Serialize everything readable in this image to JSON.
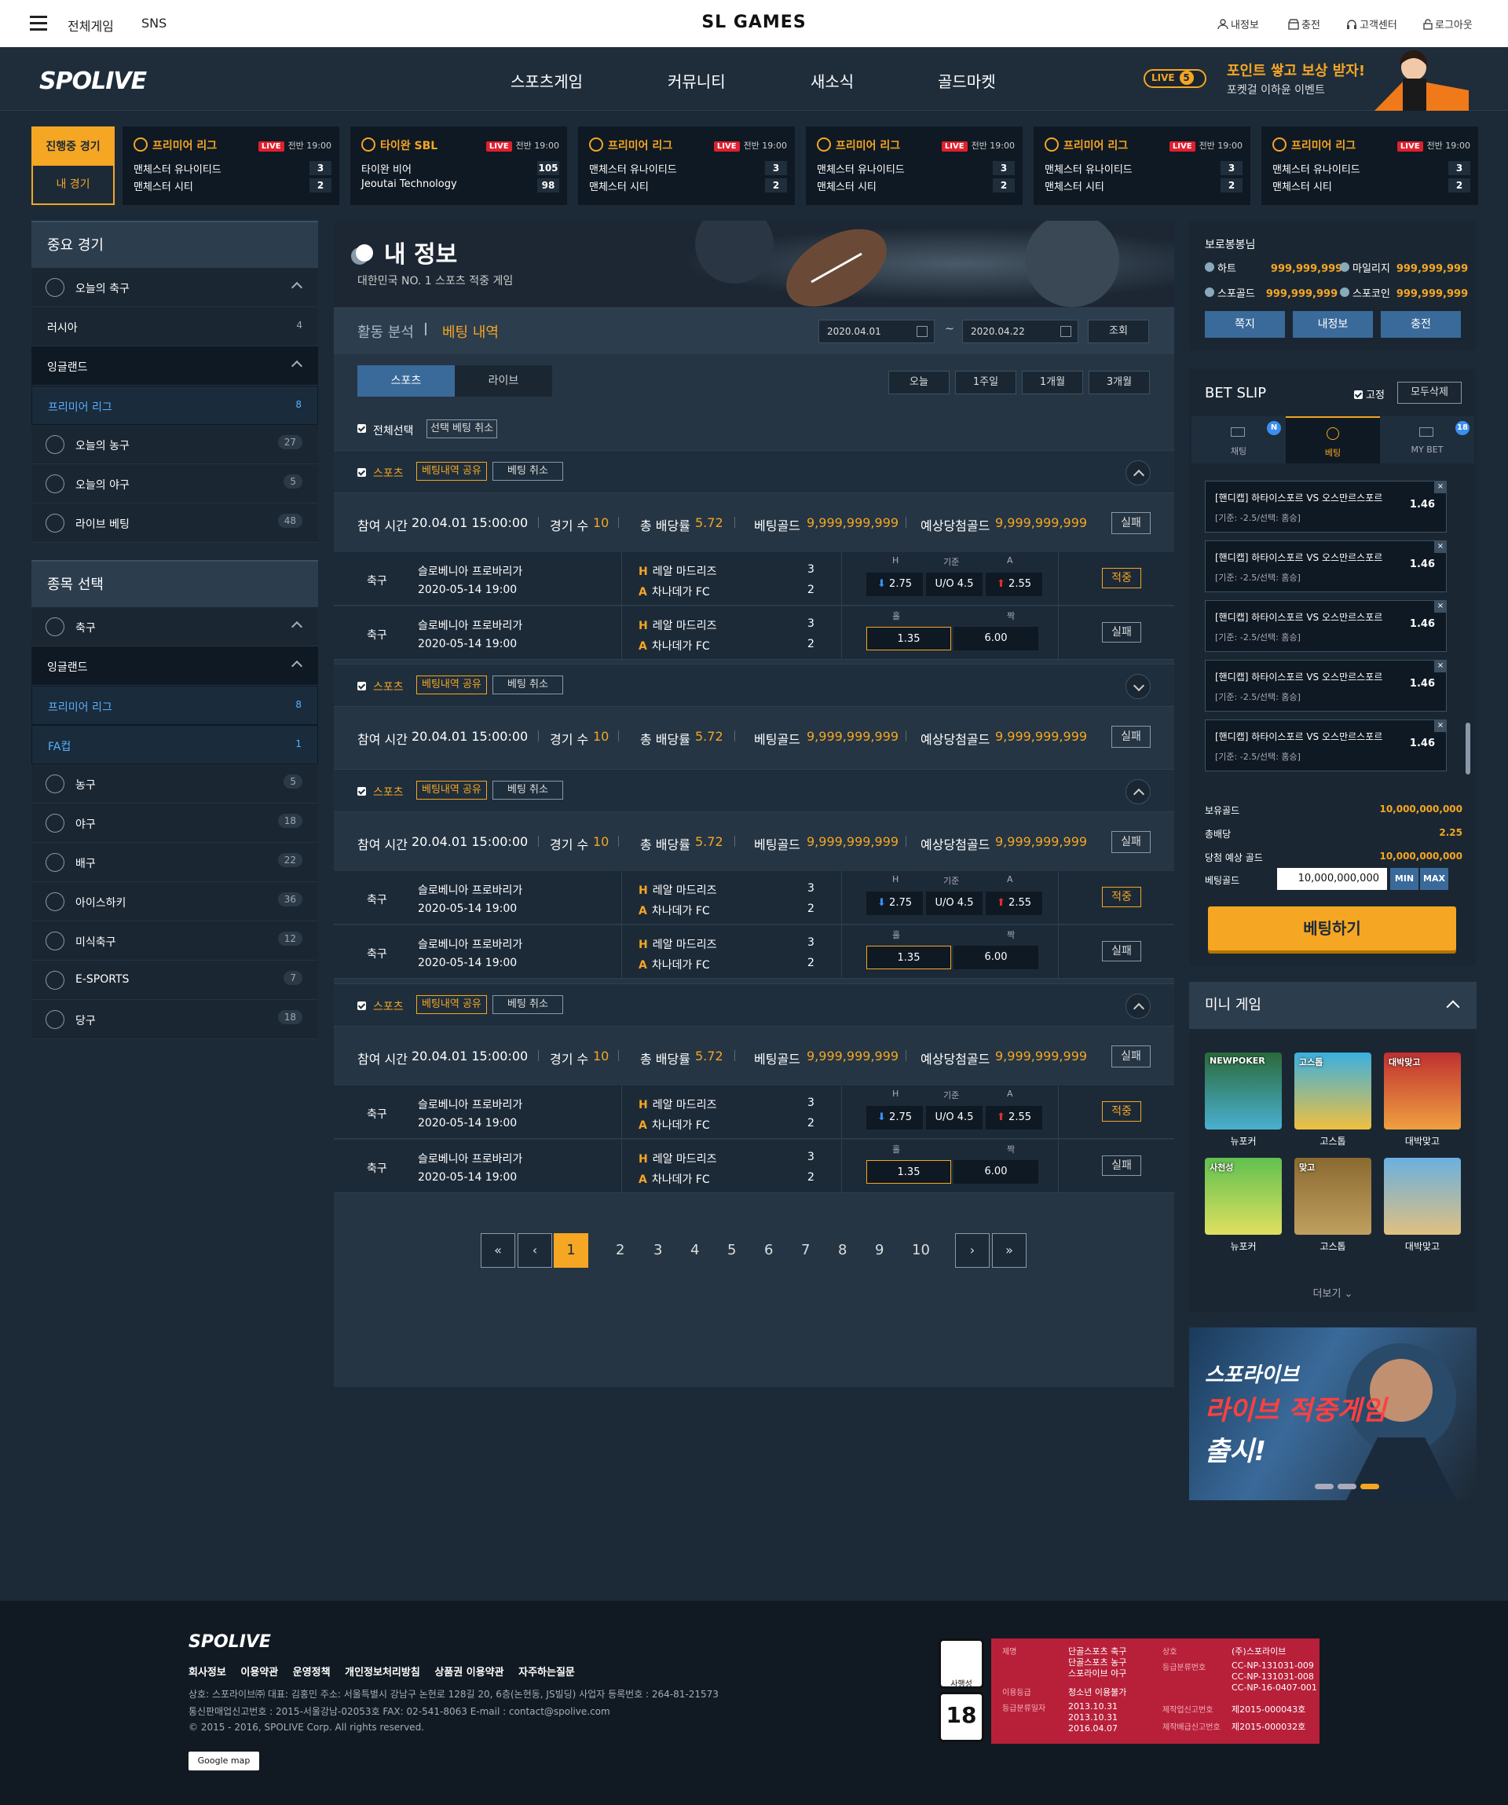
{
  "topbar": {
    "all_games": "전체게임",
    "sns": "SNS",
    "title": "SL GAMES",
    "my_info": "내정보",
    "charge": "충전",
    "support": "고객센터",
    "logout": "로그아웃"
  },
  "nav": {
    "logo": "SPOLIVE",
    "items": [
      "스포츠게임",
      "커뮤니티",
      "새소식",
      "골드마켓"
    ],
    "live_label": "LIVE",
    "live_count": "5",
    "promo_title": "포인트 쌓고 보상 받자!",
    "promo_sub": "포켓걸 이하윤 이벤트"
  },
  "strip": {
    "tab_live": "진행중 경기",
    "tab_mine": "내 경기",
    "matches": [
      {
        "league": "프리미어 리그",
        "live": "LIVE",
        "time": "전반 19:00",
        "home": "맨체스터 유나이티드",
        "away": "맨체스터 시티",
        "hs": "3",
        "as": "2"
      },
      {
        "league": "타이완 SBL",
        "live": "LIVE",
        "time": "전반 19:00",
        "home": "타이완 비어",
        "away": "Jeoutai Technology",
        "hs": "105",
        "as": "98"
      },
      {
        "league": "프리미어 리그",
        "live": "LIVE",
        "time": "전반 19:00",
        "home": "맨체스터 유나이티드",
        "away": "맨체스터 시티",
        "hs": "3",
        "as": "2"
      },
      {
        "league": "프리미어 리그",
        "live": "LIVE",
        "time": "전반 19:00",
        "home": "맨체스터 유나이티드",
        "away": "맨체스터 시티",
        "hs": "3",
        "as": "2"
      },
      {
        "league": "프리미어 리그",
        "live": "LIVE",
        "time": "전반 19:00",
        "home": "맨체스터 유나이티드",
        "away": "맨체스터 시티",
        "hs": "3",
        "as": "2"
      },
      {
        "league": "프리미어 리그",
        "live": "LIVE",
        "time": "전반 19:00",
        "home": "맨체스터 유나이티드",
        "away": "맨체스터 시티",
        "hs": "3",
        "as": "2"
      }
    ]
  },
  "left": {
    "h1": "중요 경기",
    "h2": "종목 선택",
    "group1": [
      {
        "label": "오늘의 축구",
        "count": "",
        "type": "icon",
        "up": true,
        "icon": "soccer-icon"
      },
      {
        "label": "러시아",
        "count": "4",
        "type": "sub"
      },
      {
        "label": "잉글랜드",
        "count": "",
        "type": "sub",
        "up": true,
        "dark": true
      },
      {
        "label": "프리미어 리그",
        "count": "8",
        "type": "sub",
        "sel": true
      },
      {
        "label": "오늘의 농구",
        "count": "27",
        "type": "icon",
        "icon": "basketball-icon",
        "round": true
      },
      {
        "label": "오늘의 야구",
        "count": "5",
        "type": "icon",
        "icon": "baseball-icon",
        "round": true
      },
      {
        "label": "라이브 베팅",
        "count": "48",
        "type": "icon",
        "icon": "live-icon",
        "round": true
      }
    ],
    "group2": [
      {
        "label": "축구",
        "count": "",
        "type": "icon",
        "up": true,
        "icon": "soccer-icon"
      },
      {
        "label": "잉글랜드",
        "count": "",
        "type": "sub",
        "up": true,
        "dark": true
      },
      {
        "label": "프리미어 리그",
        "count": "8",
        "type": "sub",
        "sel": true
      },
      {
        "label": "FA컵",
        "count": "1",
        "type": "sub",
        "sel": true
      },
      {
        "label": "농구",
        "count": "5",
        "type": "icon",
        "icon": "basketball-icon",
        "round": true
      },
      {
        "label": "야구",
        "count": "18",
        "type": "icon",
        "icon": "baseball-icon",
        "round": true
      },
      {
        "label": "배구",
        "count": "22",
        "type": "icon",
        "icon": "volleyball-icon",
        "round": true
      },
      {
        "label": "아이스하키",
        "count": "36",
        "type": "icon",
        "icon": "hockey-icon",
        "round": true
      },
      {
        "label": "미식축구",
        "count": "12",
        "type": "icon",
        "icon": "football-icon",
        "round": true
      },
      {
        "label": "E-SPORTS",
        "count": "7",
        "type": "icon",
        "icon": "esports-icon",
        "round": true
      },
      {
        "label": "당구",
        "count": "18",
        "type": "icon",
        "icon": "billiards-icon",
        "round": true
      }
    ]
  },
  "main": {
    "title": "내 정보",
    "subtitle": "대한민국 NO. 1 스포츠 적중 게임",
    "tab_analysis": "활동 분석",
    "tab_history": "베팅 내역",
    "date_from": "2020.04.01",
    "date_to": "2020.04.22",
    "tilde": "~",
    "search": "조회",
    "tab_sports": "스포츠",
    "tab_live": "라이브",
    "periods": [
      "오늘",
      "1주일",
      "1개월",
      "3개월"
    ],
    "select_all": "전체선택",
    "cancel_selected": "선택 베팅 취소",
    "group_label": "스포츠",
    "share": "베팅내역 공유",
    "cancel": "베팅 취소",
    "sum": {
      "time_k": "참여 시간",
      "time_v": "20.04.01 15:00:00",
      "games_k": "경기 수",
      "games_v": "10",
      "odds_k": "총 배당률",
      "odds_v": "5.72",
      "gold_k": "베팅골드",
      "gold_v": "9,999,999,999",
      "exp_k": "예상당첨골드",
      "exp_v": "9,999,999,999",
      "result": "실패"
    },
    "row1": {
      "sport": "축구",
      "league": "슬로베니아 프로바리가",
      "date": "2020-05-14 19:00",
      "hm": "H",
      "home": "레알 마드리즈",
      "aw": "A",
      "away": "차나데가 FC",
      "s1": "3",
      "s2": "2",
      "lh": "H",
      "lm": "기준",
      "la": "A",
      "o1": "2.75",
      "o2": "U/O 4.5",
      "o3": "2.55",
      "result": "적중"
    },
    "row2": {
      "sport": "축구",
      "league": "슬로베니아 프로바리가",
      "date": "2020-05-14 19:00",
      "hm": "H",
      "home": "레알 마드리즈",
      "aw": "A",
      "away": "차나데가 FC",
      "s1": "3",
      "s2": "2",
      "lh": "홀",
      "la": "짝",
      "o1": "1.35",
      "o3": "6.00",
      "result": "실패"
    },
    "pages": [
      "1",
      "2",
      "3",
      "4",
      "5",
      "6",
      "7",
      "8",
      "9",
      "10"
    ]
  },
  "wallet": {
    "title": "보로봉봉님",
    "heart_k": "하트",
    "heart_v": "999,999,999",
    "mileage_k": "마일리지",
    "mileage_v": "999,999,999",
    "sgold_k": "스포골드",
    "sgold_v": "999,999,999",
    "scoin_k": "스포코인",
    "scoin_v": "999,999,999",
    "btn1": "쪽지",
    "btn2": "내정보",
    "btn3": "충전"
  },
  "slip": {
    "title": "BET SLIP",
    "fixed": "고정",
    "delete_all": "모두삭제",
    "tab1": "채팅",
    "tab1_badge": "N",
    "tab2": "베팅",
    "tab3": "MY BET",
    "tab3_badge": "18",
    "item_title": "[핸디캡] 하타이스포르 VS 오스만르스포르",
    "item_sub": "[기준: -2.5/선택: 홈승]",
    "item_odds": "1.46",
    "item_x": "×",
    "hold_k": "보유골드",
    "hold_v": "10,000,000,000",
    "odds_k": "총배당",
    "odds_v": "2.25",
    "exp_k": "당첨 예상 골드",
    "exp_v": "10,000,000,000",
    "bet_k": "베팅골드",
    "bet_v": "10,000,000,000",
    "min": "MIN",
    "max": "MAX",
    "bet_btn": "베팅하기"
  },
  "mini": {
    "title": "미니 게임",
    "games": [
      {
        "label": "뉴포커",
        "badge": "NEWPOKER"
      },
      {
        "label": "고스톱",
        "badge": "고스톱"
      },
      {
        "label": "대박맞고",
        "badge": "대박맞고"
      },
      {
        "label": "뉴포커",
        "badge": "사천성"
      },
      {
        "label": "고스톱",
        "badge": "맞고"
      },
      {
        "label": "대박맞고",
        "badge": ""
      }
    ],
    "more": "더보기"
  },
  "banner": {
    "l1": "스포라이브",
    "l2": "라이브 적중게임",
    "l3": "출시!"
  },
  "footer": {
    "logo": "SPOLIVE",
    "links": [
      "회사정보",
      "이용약관",
      "운영정책",
      "개인정보처리방침",
      "상품권 이용약관",
      "자주하는질문"
    ],
    "line1": "상호: 스포라이브㈜    대표: 김홍민    주소: 서울특별시 강남구 논현로 128길 20, 6층(논현동, JS빌딩)    사업자 등록번호 : 264-81-21573",
    "line2": "통신판매업신고번호 : 2015-서울강남-02053호    FAX: 02-541-8063    E-mail : contact@spolive.com",
    "line3": "© 2015 - 2016, SPOLIVE Corp. All rights reserved.",
    "gmap": "Google map",
    "r_k1": "제명",
    "r_v1a": "단골스포츠 축구",
    "r_v1b": "단골스포츠 농구",
    "r_v1c": "스포라이브 야구",
    "r_k2": "이용등급",
    "r_v2": "청소년 이용불가",
    "r_k3": "등급분류일자",
    "r_v3a": "2013.10.31",
    "r_v3b": "2013.10.31",
    "r_v3c": "2016.04.07",
    "r_k4": "상호",
    "r_v4": "(주)스포라이브",
    "r_k5": "등급분류번호",
    "r_v5a": "CC-NP-131031-009",
    "r_v5b": "CC-NP-131031-008",
    "r_v5c": "CC-NP-16-0407-001",
    "r_k6": "제작업신고번호",
    "r_v6": "제2015-000043호",
    "r_k7": "제작배급신고번호",
    "r_v7": "제2015-000032호",
    "seal": "사행성",
    "age": "18"
  }
}
